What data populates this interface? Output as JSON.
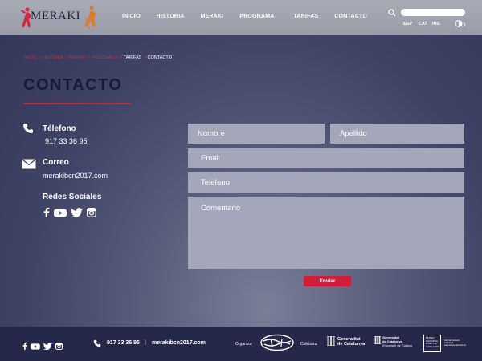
{
  "brand": {
    "name": "MERAKI",
    "accent": "#c1303d"
  },
  "nav": {
    "items": [
      {
        "label": "INICIO"
      },
      {
        "label": "HISTORIA"
      },
      {
        "label": "MERAKI"
      },
      {
        "label": "PROGRAMA"
      },
      {
        "label": "TARIFAS"
      },
      {
        "label": "CONTACTO"
      }
    ]
  },
  "search": {
    "value": "",
    "icon": "search-icon"
  },
  "languages": [
    "ESP",
    "CAT",
    "ING"
  ],
  "breadcrumb": [
    "INICIO",
    "HISTORIA",
    "MERAKI",
    "PROGRAMA",
    "TARIFAS",
    "CONTACTO"
  ],
  "breadcrumb_separator": ">",
  "page": {
    "title": "CONTACTO"
  },
  "contact": {
    "phone_label": "Télefono",
    "phone": "917 33 36 95",
    "email_label": "Correo",
    "email": "merakibcn2017.com",
    "social_label": "Redes Sociales"
  },
  "form": {
    "name_placeholder": "Nombre",
    "surname_placeholder": "Apellido",
    "email_placeholder": "Email",
    "phone_placeholder": "Telefono",
    "comment_placeholder": "Comentario",
    "submit_label": "Enviar",
    "submit_color": "#d01d3b"
  },
  "footer": {
    "phone": "917 33 36 95",
    "separator": "|",
    "email": "merakibcn2017.com",
    "organiza_label": "Organiza:",
    "colabora_label": "Colabora:",
    "gencat1_line1": "Generalitat",
    "gencat1_line2": "de Catalunya",
    "gencat2_line1": "Generalitat",
    "gencat2_line2": "de Catalunya",
    "gencat2_sub": "El consell de Cultura",
    "museum_text": "MUSEU NACIONAL D'ART DE CATALUNYA",
    "museum_sub": "Amb la Fundació Catalunya www.museunacional.cat"
  }
}
